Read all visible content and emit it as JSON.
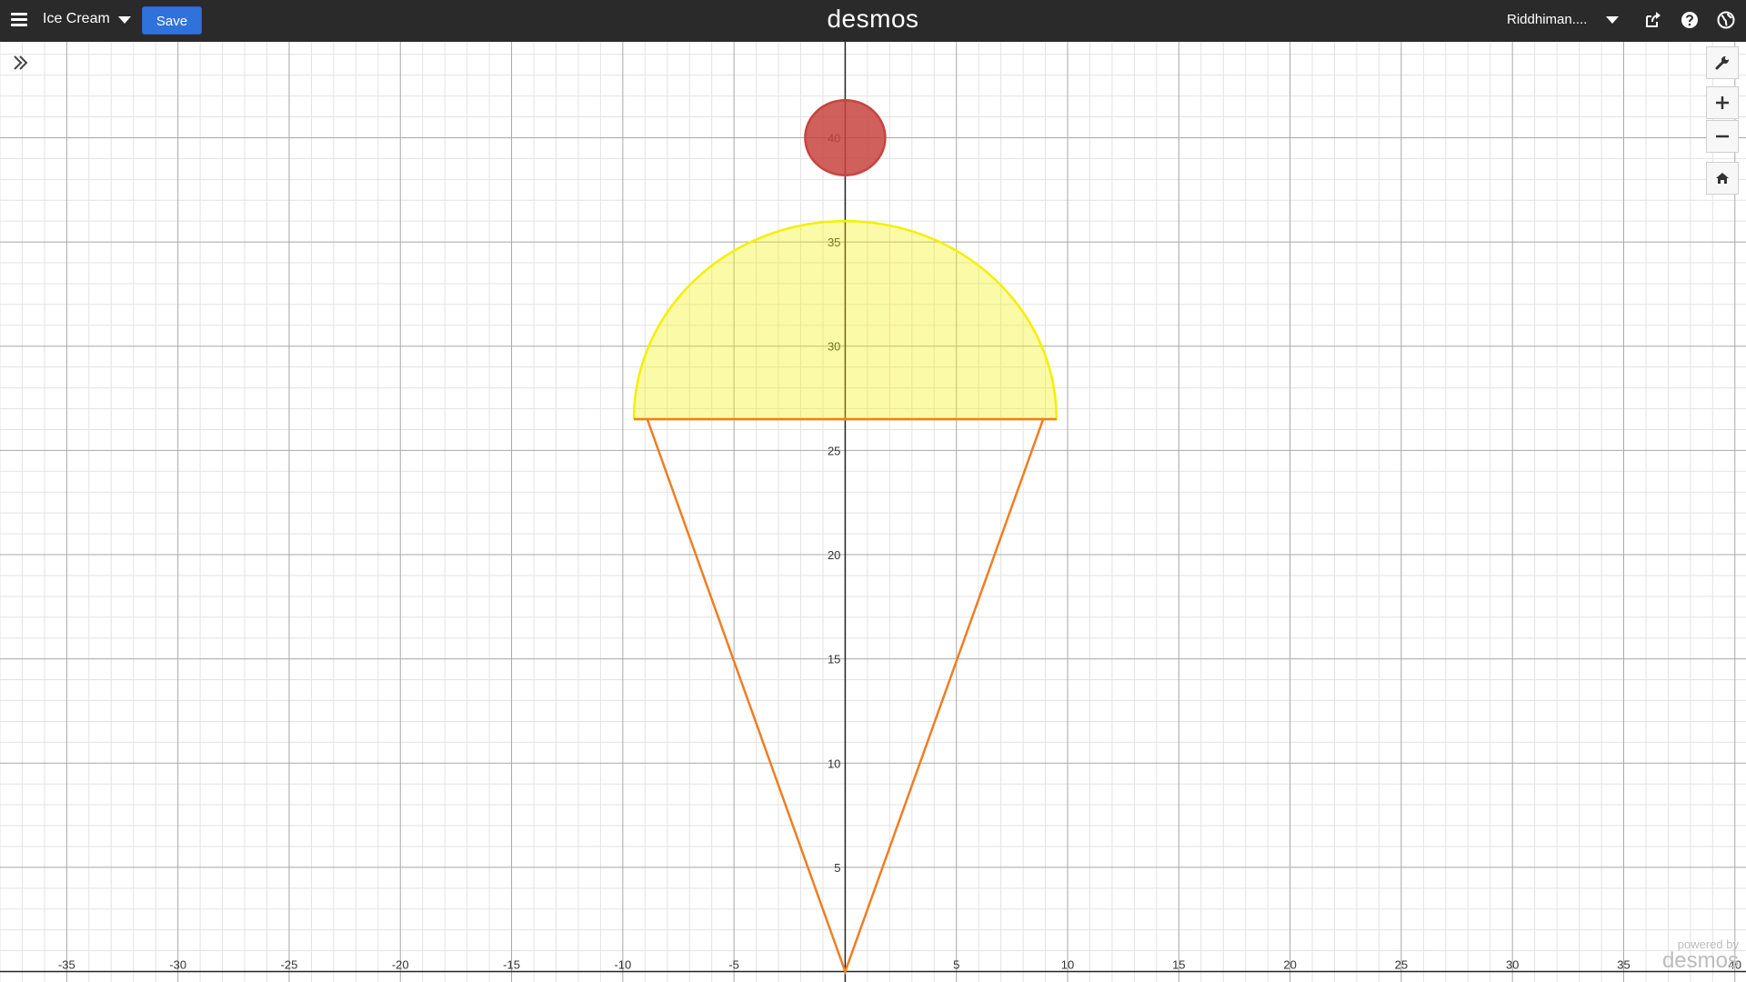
{
  "header": {
    "menu_icon": "hamburger-menu-icon",
    "graph_title": "Ice Cream",
    "save_label": "Save",
    "brand": "desmos",
    "user_name": "Riddhiman....",
    "icons": [
      "share-icon",
      "help-icon",
      "language-globe-icon"
    ]
  },
  "graph": {
    "x_range": [
      -38,
      40.5
    ],
    "y_range": [
      -0.5,
      44.6
    ],
    "grid": true,
    "x_tick_labels": [
      "-35",
      "-30",
      "-25",
      "-20",
      "-15",
      "-10",
      "-5",
      "5",
      "10",
      "15",
      "20",
      "25",
      "30",
      "35",
      "40"
    ],
    "y_tick_labels": [
      "5",
      "10",
      "15",
      "20",
      "25",
      "30",
      "35",
      "40"
    ],
    "scoop": {
      "center": [
        0,
        26.5
      ],
      "radius": 9.5,
      "color": "#f4f000"
    },
    "cone": {
      "points": [
        [
          -8.9,
          26.5
        ],
        [
          0,
          0
        ],
        [
          8.9,
          26.5
        ]
      ],
      "color": "#f07d22"
    },
    "cherry": {
      "center": [
        0,
        40
      ],
      "radius": 1.8,
      "color": "#c74440"
    },
    "colors": {
      "major_grid": "#a8a8a8",
      "minor_grid": "#e3e3e3",
      "axis": "#222222"
    }
  },
  "controls": {
    "expand_icon": "double-chevron-right-icon",
    "settings_icon": "wrench-icon",
    "zoom_in_icon": "plus-icon",
    "zoom_out_icon": "minus-icon",
    "home_icon": "home-icon"
  },
  "watermark": {
    "line1": "powered by",
    "line2": "desmos"
  }
}
